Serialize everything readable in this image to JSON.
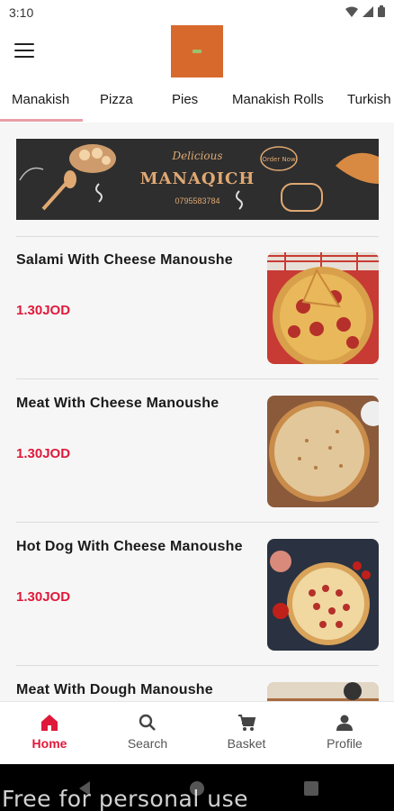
{
  "status": {
    "time": "3:10"
  },
  "header": {
    "menu_icon": "hamburger-icon",
    "logo_color": "#d8692d"
  },
  "tabs": [
    {
      "label": "Manakish",
      "active": true
    },
    {
      "label": "Pizza"
    },
    {
      "label": "Pies"
    },
    {
      "label": "Manakish Rolls"
    },
    {
      "label": "Turkish"
    }
  ],
  "banner": {
    "subtitle": "Delicious",
    "title": "MANAQICH",
    "phone": "0795583784",
    "bubble": "Order Now"
  },
  "items": [
    {
      "name": "Salami With Cheese Manoushe",
      "price": "1.30JOD"
    },
    {
      "name": "Meat With Cheese Manoushe",
      "price": "1.30JOD"
    },
    {
      "name": "Hot Dog With Cheese Manoushe",
      "price": "1.30JOD"
    },
    {
      "name": "Meat With Dough Manoushe",
      "price": ""
    }
  ],
  "bottom_nav": [
    {
      "label": "Home",
      "icon": "home-icon",
      "active": true
    },
    {
      "label": "Search",
      "icon": "search-icon"
    },
    {
      "label": "Basket",
      "icon": "cart-icon"
    },
    {
      "label": "Profile",
      "icon": "person-icon"
    }
  ],
  "watermark": "Free for personal use",
  "colors": {
    "accent": "#e0193a",
    "banner_bg": "#2e2e2e",
    "banner_text": "#e0a873"
  }
}
